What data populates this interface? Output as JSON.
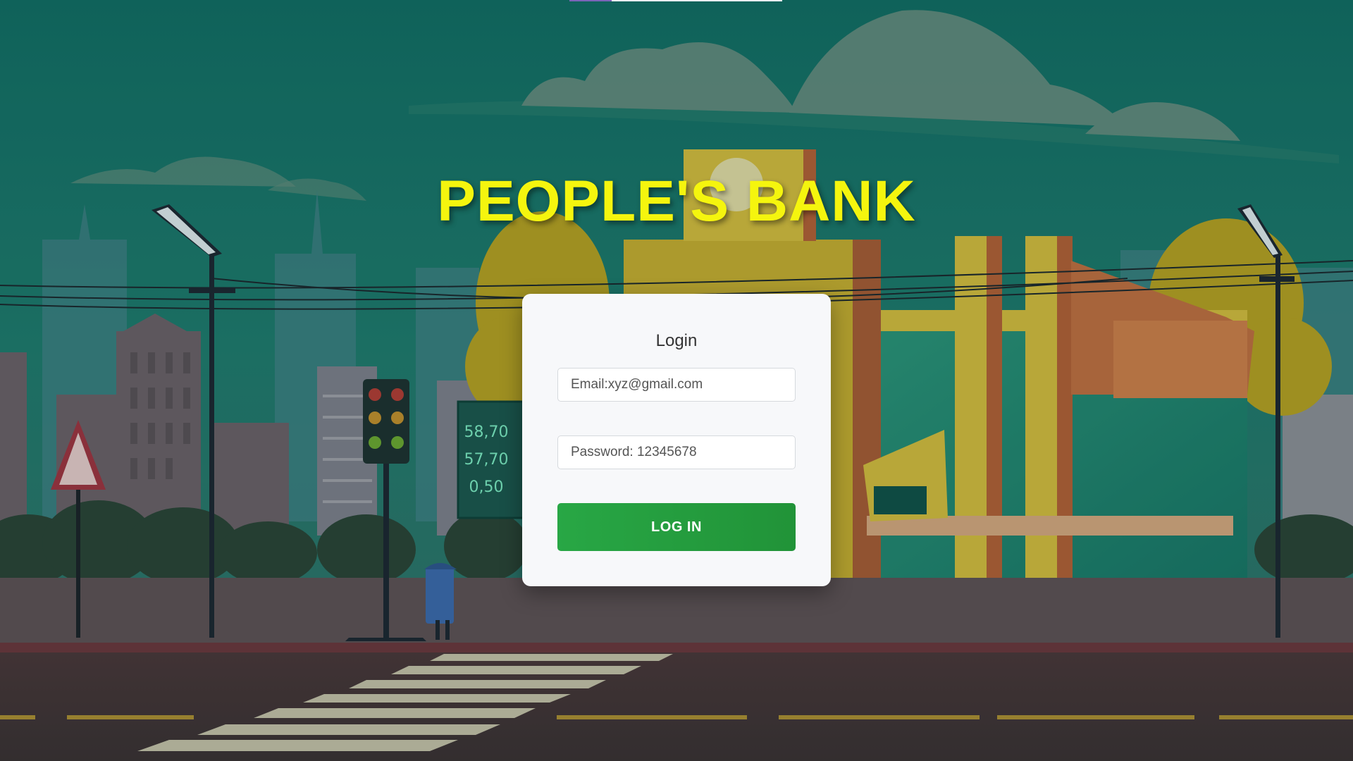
{
  "page": {
    "bank_title": "PEOPLE'S BANK"
  },
  "login_form": {
    "heading": "Login",
    "email_placeholder": "Email:xyz@gmail.com",
    "password_placeholder": "Password: 12345678",
    "submit_label": "LOG IN"
  },
  "background": {
    "price_board": [
      "58,70",
      "57,70",
      "0,50"
    ]
  },
  "colors": {
    "title": "#f5f50e",
    "button": "#28a745",
    "card": "#f7f8fa",
    "sky": "#11695f"
  }
}
